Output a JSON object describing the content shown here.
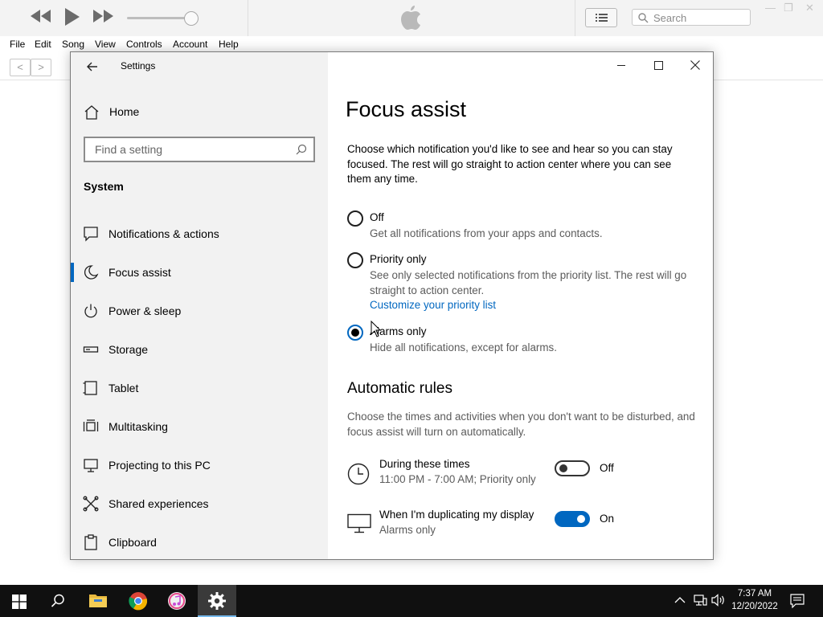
{
  "itunes": {
    "search_placeholder": "Search",
    "menu": [
      "File",
      "Edit",
      "Song",
      "View",
      "Controls",
      "Account",
      "Help"
    ]
  },
  "settings": {
    "window_title": "Settings",
    "home_label": "Home",
    "search_placeholder": "Find a setting",
    "section_label": "System",
    "nav_items": [
      {
        "label": "Notifications & actions",
        "icon": "notification-icon"
      },
      {
        "label": "Focus assist",
        "icon": "moon-icon",
        "selected": true
      },
      {
        "label": "Power & sleep",
        "icon": "power-icon"
      },
      {
        "label": "Storage",
        "icon": "storage-icon"
      },
      {
        "label": "Tablet",
        "icon": "tablet-icon"
      },
      {
        "label": "Multitasking",
        "icon": "multitasking-icon"
      },
      {
        "label": "Projecting to this PC",
        "icon": "projecting-icon"
      },
      {
        "label": "Shared experiences",
        "icon": "shared-icon"
      },
      {
        "label": "Clipboard",
        "icon": "clipboard-icon"
      }
    ],
    "page_title": "Focus assist",
    "intro": "Choose which notification you'd like to see and hear so you can stay focused. The rest will go straight to action center where you can see them any time.",
    "options": [
      {
        "label": "Off",
        "desc": "Get all notifications from your apps and contacts.",
        "selected": false
      },
      {
        "label": "Priority only",
        "desc": "See only selected notifications from the priority list. The rest will go straight to action center.",
        "link": "Customize your priority list",
        "selected": false
      },
      {
        "label": "Alarms only",
        "desc": "Hide all notifications, except for alarms.",
        "selected": true
      }
    ],
    "rules_heading": "Automatic rules",
    "rules_intro": "Choose the times and activities when you don't want to be disturbed, and focus assist will turn on automatically.",
    "rules": [
      {
        "title": "During these times",
        "subtitle": "11:00 PM - 7:00 AM; Priority only",
        "state": "Off",
        "on": false,
        "icon": "clock-icon"
      },
      {
        "title": "When I'm duplicating my display",
        "subtitle": "Alarms only",
        "state": "On",
        "on": true,
        "icon": "monitor-icon"
      }
    ]
  },
  "taskbar": {
    "time": "7:37 AM",
    "date": "12/20/2022"
  },
  "colors": {
    "accent": "#0067c0",
    "sidebar_bg": "#f2f2f2",
    "taskbar_bg": "#101010"
  }
}
